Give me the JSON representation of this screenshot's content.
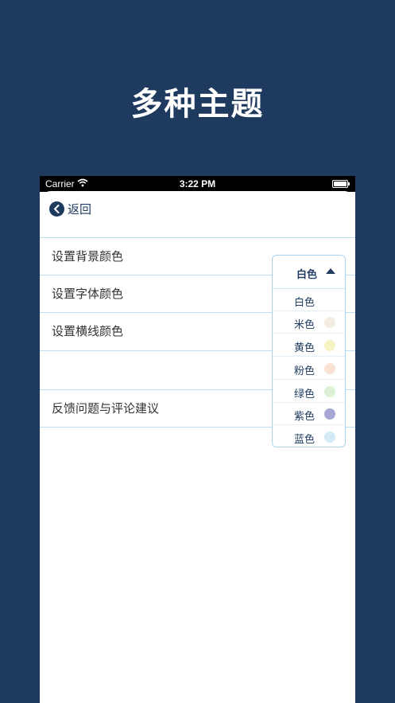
{
  "headline": "多种主题",
  "status_bar": {
    "carrier": "Carrier",
    "time": "3:22 PM"
  },
  "nav": {
    "back_label": "返回"
  },
  "settings_rows": [
    {
      "label": "设置背景颜色"
    },
    {
      "label": "设置字体颜色"
    },
    {
      "label": "设置横线颜色"
    },
    {
      "label": ""
    },
    {
      "label": "反馈问题与评论建议"
    }
  ],
  "color_dropdown": {
    "selected": "白色",
    "options": [
      {
        "label": "白色",
        "color": ""
      },
      {
        "label": "米色",
        "color": "#f3ece0"
      },
      {
        "label": "黄色",
        "color": "#f5f3c4"
      },
      {
        "label": "粉色",
        "color": "#fbe2d6"
      },
      {
        "label": "绿色",
        "color": "#dcf1d6"
      },
      {
        "label": "紫色",
        "color": "#a6a8d3"
      },
      {
        "label": "蓝色",
        "color": "#d3eaf7"
      }
    ]
  }
}
